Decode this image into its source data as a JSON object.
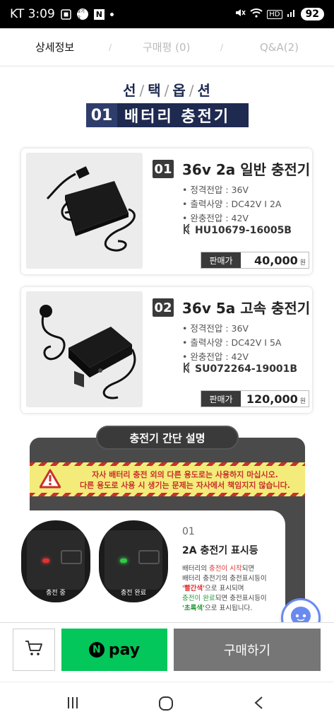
{
  "status_bar": {
    "carrier_time": "KT 3:09",
    "circle_icon_text": "요기요",
    "n_icon_text": "N",
    "hd_label": "HD",
    "battery": "92"
  },
  "tabs": [
    {
      "label": "상세정보",
      "active": true
    },
    {
      "label": "구매평 (0)",
      "active": false
    },
    {
      "label": "Q&A(2)",
      "active": false
    }
  ],
  "tab_separator": "/",
  "option_title": {
    "parts": [
      "선",
      "택",
      "옵",
      "션"
    ],
    "separator": "/"
  },
  "section": {
    "num": "01",
    "name": "배터리 충전기"
  },
  "products": [
    {
      "num": "01",
      "title": "36v 2a 일반 충전기",
      "specs": [
        "• 정격전압 : 36V",
        "• 출력사양 : DC42V  I  2A",
        "• 완충전압 : 42V"
      ],
      "cert": "HU10679-16005B",
      "price_label": "판매가",
      "price": "40,000",
      "currency": "원"
    },
    {
      "num": "02",
      "title": "36v 5a 고속 충전기",
      "specs": [
        "• 정격전압 : 36V",
        "• 출력사양 : DC42V  I  5A",
        "• 완충전압 : 42V"
      ],
      "cert": "SU072264-19001B",
      "price_label": "판매가",
      "price": "120,000",
      "currency": "원"
    }
  ],
  "description": {
    "title": "충전기 간단 설명",
    "warning_line1": "자사 배터리 충전 외의 다른 용도로는 사용하지 마십시오.",
    "warning_line2": "다른 용도로 사용 시 생기는 문제는 자사에서 책임지지 않습니다.",
    "led_charging": "충전 중",
    "led_done": "충전 완료",
    "info_num": "01",
    "info_title": "2A 충전기 표시등",
    "info_t1": "배터리의 ",
    "info_t2": "충전이 시작",
    "info_t3": "되면",
    "info_t4": "배터리 충전기의 충전표시등이",
    "info_t5": "'빨간색'",
    "info_t6": "으로 표시되며",
    "info_t7": "충전이 완료",
    "info_t8": "되면 충전표시등이",
    "info_t9": "'초록색'",
    "info_t10": "으로 표시됩니다."
  },
  "actions": {
    "npay_n": "N",
    "npay_label": "pay",
    "buy_label": "구매하기"
  },
  "colors": {
    "navy": "#1e2a50",
    "npay_green": "#03c75a",
    "buy_gray": "#767676",
    "warn_red": "#c9302c"
  }
}
